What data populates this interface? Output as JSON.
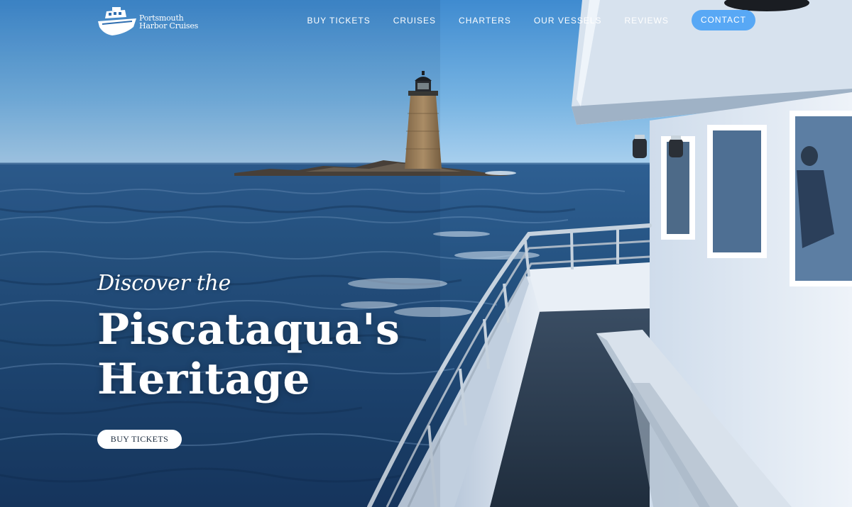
{
  "brand": {
    "name_line1": "Portsmouth",
    "name_line2": "Harbor Cruises",
    "logo_icon": "boat-icon"
  },
  "nav": {
    "items": [
      {
        "label": "BUY TICKETS"
      },
      {
        "label": "CRUISES"
      },
      {
        "label": "CHARTERS"
      },
      {
        "label": "OUR VESSELS"
      },
      {
        "label": "REVIEWS"
      }
    ],
    "contact_label": "CONTACT"
  },
  "hero": {
    "eyebrow": "Discover the",
    "title_line1": "Piscataqua's",
    "title_line2": "Heritage",
    "cta_label": "BUY TICKETS"
  },
  "colors": {
    "accent": "#58a8f5",
    "sky": "#6fb0e0",
    "ocean": "#1d4b7e",
    "text": "#ffffff"
  }
}
